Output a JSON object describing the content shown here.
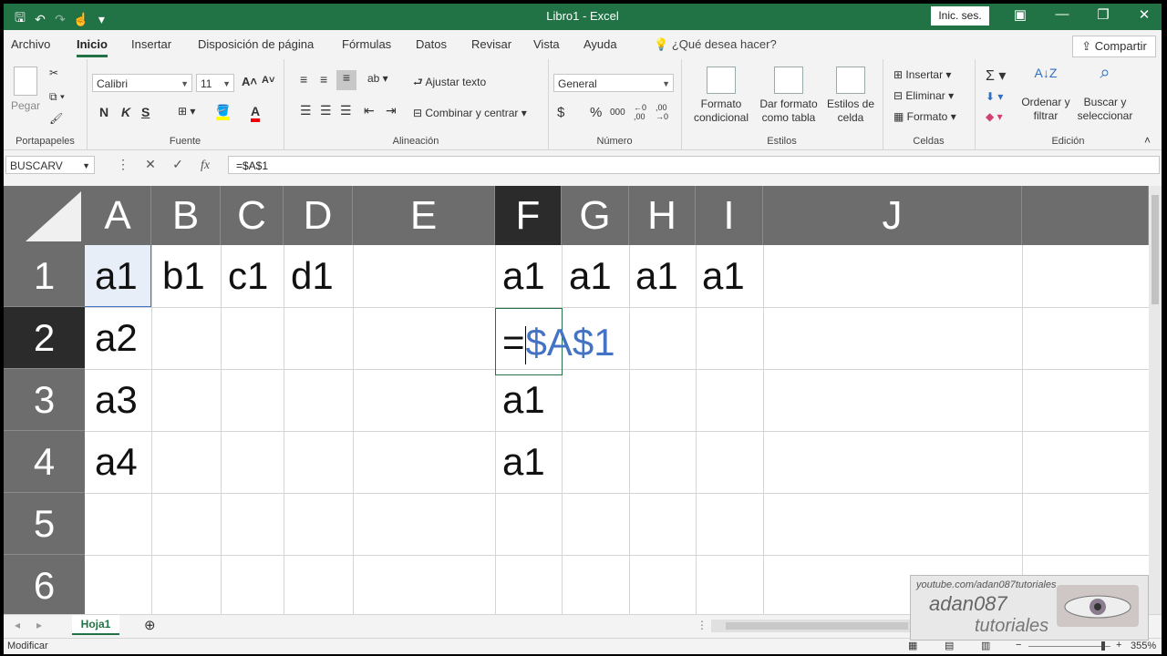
{
  "app": {
    "window_title": "Libro1  -  Excel",
    "signin": "Inic. ses.",
    "colors": {
      "brand": "#217346",
      "header_gray": "#6d6d6d",
      "header_selected": "#2b2b2b",
      "ref_blue": "#4472c4"
    }
  },
  "ribbon_tabs": [
    "Archivo",
    "Inicio",
    "Insertar",
    "Disposición de página",
    "Fórmulas",
    "Datos",
    "Revisar",
    "Vista",
    "Ayuda"
  ],
  "tellme": "¿Qué desea hacer?",
  "share": "Compartir",
  "ribbon": {
    "clipboard": {
      "paste": "Pegar",
      "label": "Portapapeles"
    },
    "font": {
      "name": "Calibri",
      "size": "11",
      "bold": "N",
      "italic": "K",
      "underline": "S",
      "label": "Fuente"
    },
    "alignment": {
      "wrap": "Ajustar texto",
      "merge": "Combinar y centrar",
      "label": "Alineación"
    },
    "number": {
      "format": "General",
      "currency": "$",
      "percent": "%",
      "thousands": "000",
      "label": "Número"
    },
    "styles": {
      "conditional": "Formato condicional",
      "table": "Dar formato como tabla",
      "cell": "Estilos de celda",
      "label": "Estilos"
    },
    "cells": {
      "insert": "Insertar",
      "delete": "Eliminar",
      "format": "Formato",
      "label": "Celdas"
    },
    "editing": {
      "sort": "Ordenar y filtrar",
      "find": "Buscar y seleccionar",
      "label": "Edición"
    }
  },
  "formula_bar": {
    "name_box": "BUSCARV",
    "formula": "=$A$1"
  },
  "columns": [
    "A",
    "B",
    "C",
    "D",
    "E",
    "F",
    "G",
    "H",
    "I",
    "J"
  ],
  "rows": [
    "1",
    "2",
    "3",
    "4",
    "5",
    "6"
  ],
  "cells": {
    "A1": "a1",
    "B1": "b1",
    "C1": "c1",
    "D1": "d1",
    "F1": "a1",
    "G1": "a1",
    "H1": "a1",
    "I1": "a1",
    "A2": "a2",
    "A3": "a3",
    "A4": "a4",
    "F2_eq": "=",
    "F2_ref": "$A$1",
    "F3": "a1",
    "F4": "a1"
  },
  "sheet": {
    "tab": "Hoja1"
  },
  "status": {
    "mode": "Modificar",
    "zoom": "355%"
  },
  "watermark": {
    "url": "youtube.com/adan087tutoriales",
    "name": "adan087",
    "sub": "tutoriales"
  }
}
